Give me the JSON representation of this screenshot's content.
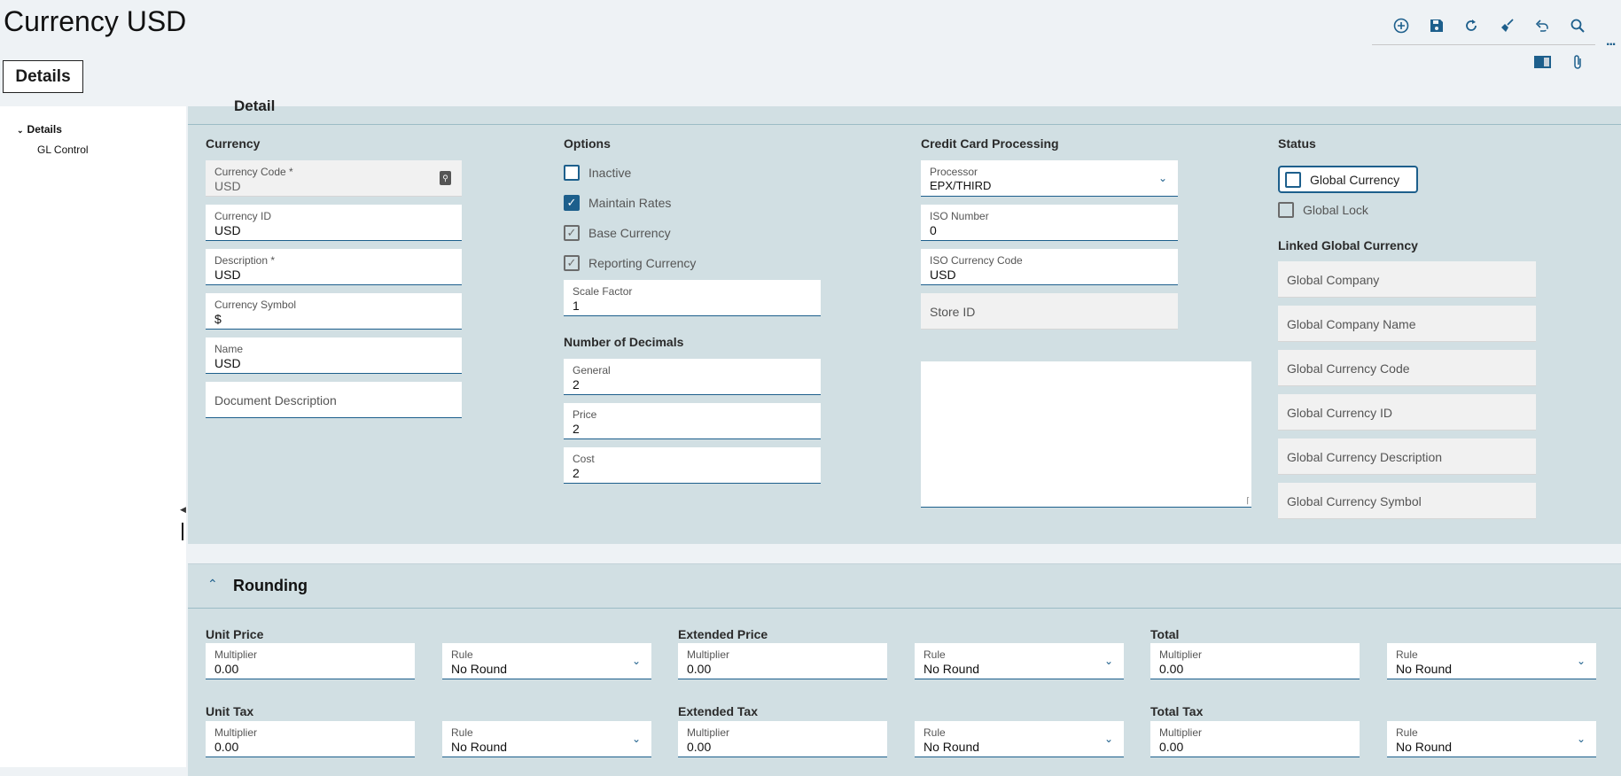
{
  "header": {
    "title": "Currency USD",
    "tab": "Details",
    "more": "..."
  },
  "toolbar": [
    "add-icon",
    "save-icon",
    "refresh-icon",
    "clear-icon",
    "undo-icon",
    "search-icon",
    "panel-icon",
    "attachment-icon"
  ],
  "sidebar": {
    "items": [
      {
        "label": "Details",
        "expanded": true
      },
      {
        "label": "GL Control"
      }
    ]
  },
  "detail": {
    "section_title": "Detail",
    "currency": {
      "heading": "Currency",
      "fields": [
        {
          "label": "Currency Code *",
          "value": "USD"
        },
        {
          "label": "Currency ID",
          "value": "USD"
        },
        {
          "label": "Description *",
          "value": "USD"
        },
        {
          "label": "Currency Symbol",
          "value": "$"
        },
        {
          "label": "Name",
          "value": "USD"
        },
        {
          "placeholder": "Document Description"
        }
      ]
    },
    "options": {
      "heading": "Options",
      "checkboxes": [
        {
          "label": "Inactive",
          "checked": false
        },
        {
          "label": "Maintain Rates",
          "checked": true
        },
        {
          "label": "Base Currency",
          "checked": true,
          "disabled": true
        },
        {
          "label": "Reporting Currency",
          "checked": true,
          "disabled": true
        }
      ],
      "scale_factor": {
        "label": "Scale Factor",
        "value": "1"
      },
      "decimals_heading": "Number of Decimals",
      "decimals": [
        {
          "label": "General",
          "value": "2"
        },
        {
          "label": "Price",
          "value": "2"
        },
        {
          "label": "Cost",
          "value": "2"
        }
      ]
    },
    "credit": {
      "heading": "Credit Card Processing",
      "processor": {
        "label": "Processor",
        "value": "EPX/THIRD"
      },
      "iso_number": {
        "label": "ISO Number",
        "value": "0"
      },
      "iso_code": {
        "label": "ISO Currency Code",
        "value": "USD"
      },
      "store_id": {
        "placeholder": "Store ID"
      }
    },
    "status": {
      "heading": "Status",
      "global_currency": "Global Currency",
      "global_lock": "Global Lock",
      "linked_heading": "Linked Global Currency",
      "linked": [
        "Global Company",
        "Global Company Name",
        "Global Currency Code",
        "Global Currency ID",
        "Global Currency Description",
        "Global Currency Symbol"
      ]
    }
  },
  "rounding": {
    "title": "Rounding",
    "multiplier_label": "Multiplier",
    "rule_label": "Rule",
    "groups": [
      {
        "heading": "Unit Price",
        "multiplier": "0.00",
        "rule": "No Round"
      },
      {
        "heading": "Extended Price",
        "multiplier": "0.00",
        "rule": "No Round"
      },
      {
        "heading": "Total",
        "multiplier": "0.00",
        "rule": "No Round"
      },
      {
        "heading": "Unit Tax",
        "multiplier": "0.00",
        "rule": "No Round"
      },
      {
        "heading": "Extended Tax",
        "multiplier": "0.00",
        "rule": "No Round"
      },
      {
        "heading": "Total Tax",
        "multiplier": "0.00",
        "rule": "No Round"
      }
    ]
  }
}
